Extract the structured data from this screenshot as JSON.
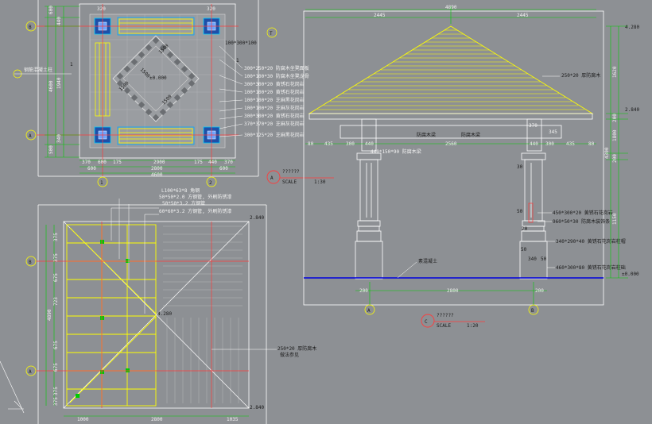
{
  "plan_top": {
    "row_bubbles": [
      "B",
      "A"
    ],
    "col_bubbles": [
      "1",
      "2"
    ],
    "top_dims": [
      "320",
      "320"
    ],
    "left_dims": [
      "600",
      "440",
      "1940",
      "4600",
      "340",
      "500"
    ],
    "left_note": "钢筋混凝土柱",
    "left_side_mark": "1",
    "bottom_dims_row1": [
      "370",
      "600",
      "175",
      "2900",
      "175",
      "440",
      "370"
    ],
    "bottom_dims_row2": [
      "600",
      "2800",
      "600"
    ],
    "bottom_total": "4600",
    "center_elev": "±0.000",
    "diag_labels": [
      "1500",
      "1500",
      "1500",
      "1500"
    ],
    "right_mark": "1",
    "right_note": "100*300*100",
    "notes": [
      "300*250*20 防腐木坐凳面板",
      "100*100*30 防腐木坐凳龙骨",
      "300*300*20 黄锈石花岗岩",
      "100*100*20 黄锈石花岗岩",
      "100*100*20 芝麻黑花岗岩",
      "100*100*20 芝麻灰花岗岩",
      "300*300*20 黄锈石花岗岩",
      "370*370*20 芝麻灰花岗岩",
      "300*125*20 芝麻黑花岗岩"
    ],
    "pole_mark": "T"
  },
  "section_a": {
    "title": "??????",
    "scale_label": "SCALE",
    "scale": "1:30",
    "letter": "A"
  },
  "section_c": {
    "title": "??????",
    "scale_label": "SCALE",
    "scale": "1:20",
    "letter": "C"
  },
  "elevation": {
    "top_dims": [
      "2445",
      "2445"
    ],
    "top_total": "4890",
    "roof_note": "250*20 厚防腐木",
    "right_dims": [
      "1620",
      "200",
      "1800",
      "200",
      "1150",
      "4300"
    ],
    "right_elevs": [
      "4.280",
      "2.840",
      "±0.000"
    ],
    "beam_dims": [
      "80",
      "435",
      "300",
      "440",
      "2560",
      "440",
      "300",
      "435",
      "80"
    ],
    "beam_labels": [
      "防腐木梁",
      "防腐木梁"
    ],
    "beam_note": "440*150*90 防腐木梁",
    "bracket_dims": [
      "370",
      "345"
    ],
    "col_notes": [
      "450*300*20 黄锈石花岗岩",
      "960*50*30 防腐木装饰条",
      "340*290*40 黄锈石花岗岩柱帽",
      "460*300*80 黄锈石花岗岩柱础"
    ],
    "ground_note": "素混凝土",
    "bottom_dims": [
      "200",
      "2800",
      "200"
    ],
    "small_dims": [
      "30",
      "50",
      "20",
      "50",
      "340",
      "50"
    ],
    "axis_bubbles": [
      "A",
      "B"
    ]
  },
  "roof_plan": {
    "notes": [
      "L100*63*8 角钢",
      "50*50*2.0 方钢管, 外刷防锈漆",
      "50*50*3.2 方钢管",
      "60*60*3.2 方钢管, 外刷防锈漆"
    ],
    "left_dims": [
      "375",
      "375",
      "675",
      "723",
      "675",
      "675",
      "375",
      "375"
    ],
    "left_total": "4890",
    "row_bubbles": [
      "B",
      "A"
    ],
    "elevs": [
      "2.840",
      "4.280",
      "2.840"
    ],
    "tile_note": "250*20 厚防腐木",
    "tile_note2": "做法参见",
    "bottom_dims": [
      "1000",
      "2800",
      "1035"
    ]
  },
  "colors": {
    "background": "#8d9094",
    "structure": "#ffff00",
    "dimension": "#00cc00",
    "axis": "#ff3b3b",
    "column": "#00aaff",
    "line": "#ffffff",
    "ground": "#0000dd"
  }
}
